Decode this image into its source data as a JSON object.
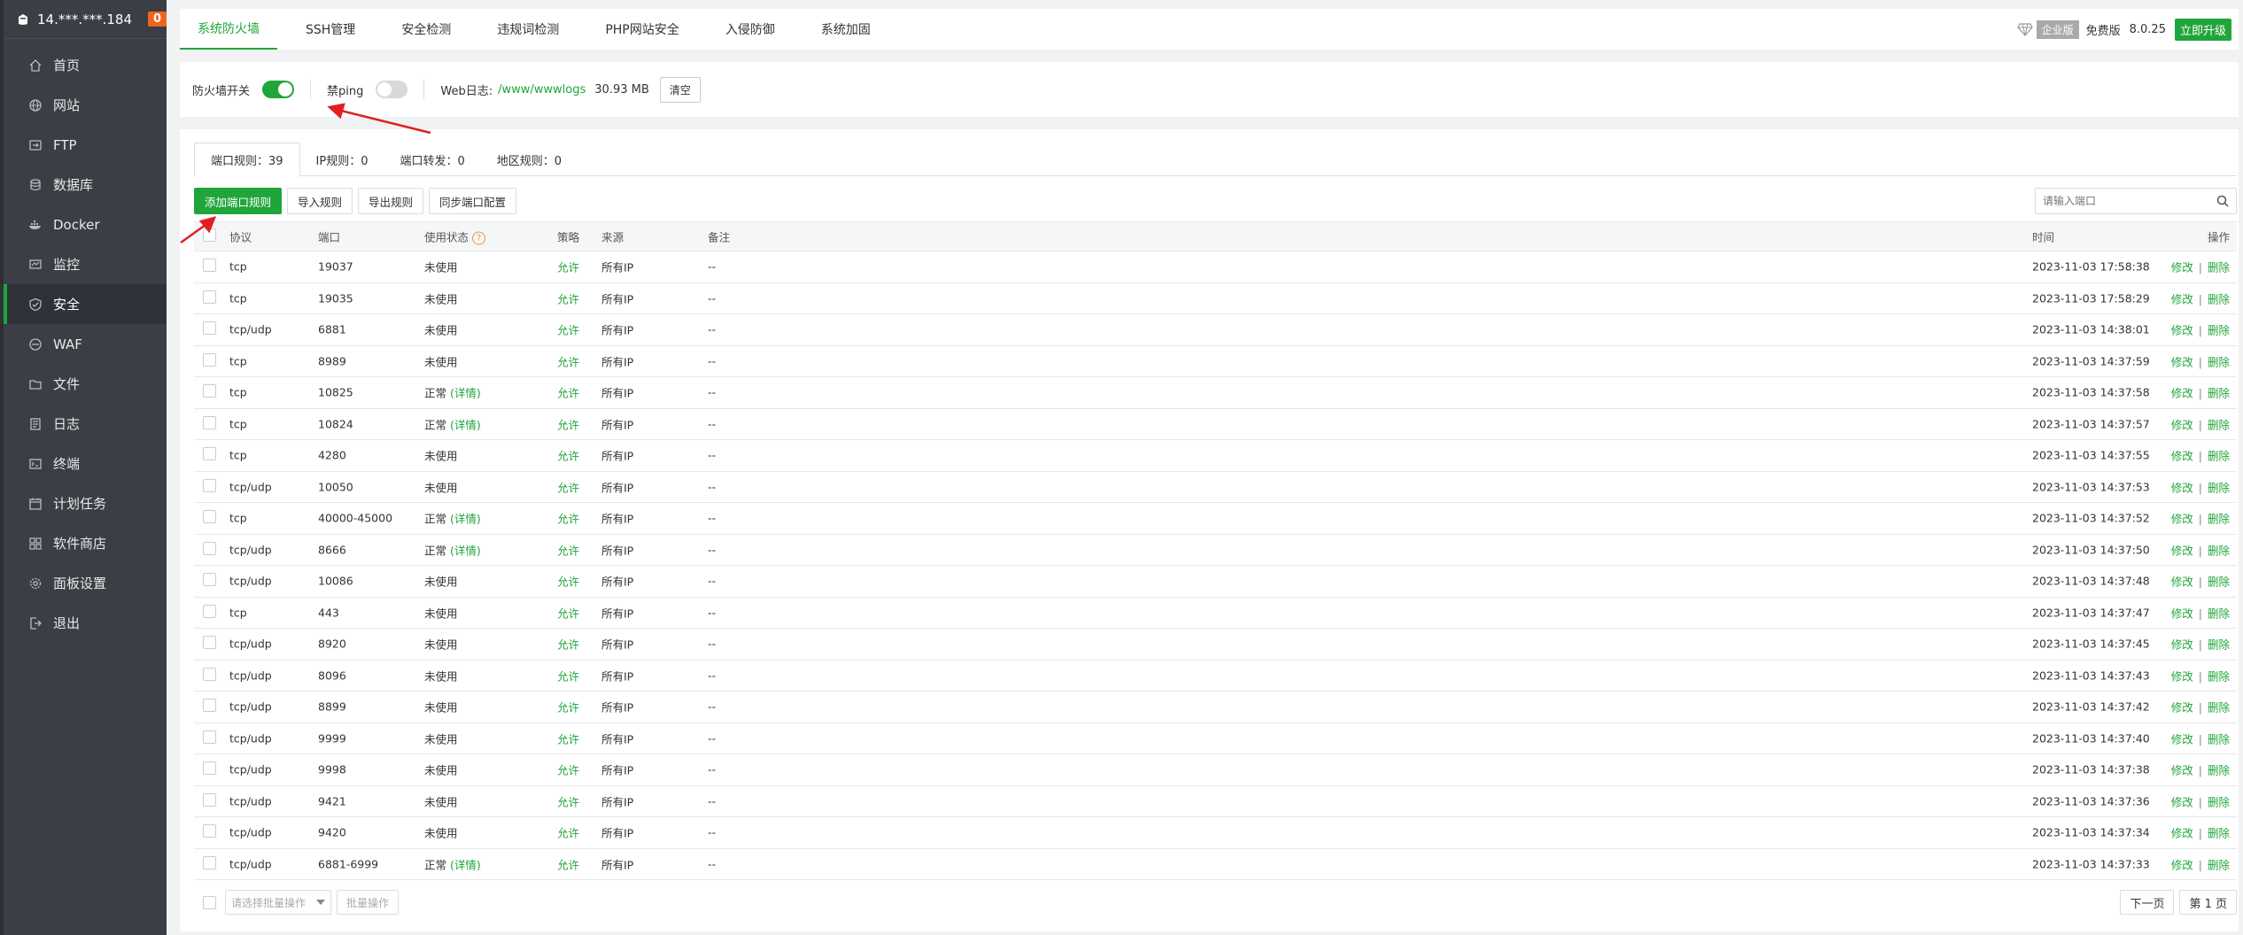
{
  "sidebar": {
    "server_ip": "14.***.***.184",
    "badge": "0",
    "items": [
      {
        "label": "首页",
        "icon": "home-icon"
      },
      {
        "label": "网站",
        "icon": "globe-icon"
      },
      {
        "label": "FTP",
        "icon": "ftp-icon"
      },
      {
        "label": "数据库",
        "icon": "database-icon"
      },
      {
        "label": "Docker",
        "icon": "docker-icon"
      },
      {
        "label": "监控",
        "icon": "monitor-icon"
      },
      {
        "label": "安全",
        "icon": "shield-icon",
        "active": true
      },
      {
        "label": "WAF",
        "icon": "waf-icon"
      },
      {
        "label": "文件",
        "icon": "folder-icon"
      },
      {
        "label": "日志",
        "icon": "log-icon"
      },
      {
        "label": "终端",
        "icon": "terminal-icon"
      },
      {
        "label": "计划任务",
        "icon": "calendar-icon"
      },
      {
        "label": "软件商店",
        "icon": "apps-icon"
      },
      {
        "label": "面板设置",
        "icon": "gear-icon"
      },
      {
        "label": "退出",
        "icon": "logout-icon"
      }
    ]
  },
  "topbar": {
    "tabs": [
      "系统防火墙",
      "SSH管理",
      "安全检测",
      "违规词检测",
      "PHP网站安全",
      "入侵防御",
      "系统加固"
    ],
    "active_tab": 0,
    "enterprise": "企业版",
    "free": "免费版",
    "version": "8.0.25",
    "upgrade": "立即升级"
  },
  "firewall": {
    "switch_label": "防火墙开关",
    "switch_on": true,
    "ping_label": "禁ping",
    "ping_on": false,
    "weblog_label": "Web日志:",
    "weblog_path": "/www/wwwlogs",
    "weblog_size": "30.93 MB",
    "clear_label": "清空"
  },
  "subtabs": [
    "端口规则：39",
    "IP规则：0",
    "端口转发：0",
    "地区规则：0"
  ],
  "toolbar": {
    "add": "添加端口规则",
    "import": "导入规则",
    "export": "导出规则",
    "sync": "同步端口配置",
    "search_placeholder": "请输入端口"
  },
  "table": {
    "headers": {
      "proto": "协议",
      "port": "端口",
      "status": "使用状态",
      "policy": "策略",
      "source": "来源",
      "note": "备注",
      "time": "时间",
      "ops": "操作"
    },
    "detail_label": "(详情)",
    "edit_label": "修改",
    "delete_label": "删除",
    "rows": [
      {
        "proto": "tcp",
        "port": "19037",
        "status": "未使用",
        "detail": false,
        "policy": "允许",
        "source": "所有IP",
        "note": "--",
        "time": "2023-11-03 17:58:38"
      },
      {
        "proto": "tcp",
        "port": "19035",
        "status": "未使用",
        "detail": false,
        "policy": "允许",
        "source": "所有IP",
        "note": "--",
        "time": "2023-11-03 17:58:29"
      },
      {
        "proto": "tcp/udp",
        "port": "6881",
        "status": "未使用",
        "detail": false,
        "policy": "允许",
        "source": "所有IP",
        "note": "--",
        "time": "2023-11-03 14:38:01"
      },
      {
        "proto": "tcp",
        "port": "8989",
        "status": "未使用",
        "detail": false,
        "policy": "允许",
        "source": "所有IP",
        "note": "--",
        "time": "2023-11-03 14:37:59"
      },
      {
        "proto": "tcp",
        "port": "10825",
        "status": "正常",
        "detail": true,
        "policy": "允许",
        "source": "所有IP",
        "note": "--",
        "time": "2023-11-03 14:37:58"
      },
      {
        "proto": "tcp",
        "port": "10824",
        "status": "正常",
        "detail": true,
        "policy": "允许",
        "source": "所有IP",
        "note": "--",
        "time": "2023-11-03 14:37:57"
      },
      {
        "proto": "tcp",
        "port": "4280",
        "status": "未使用",
        "detail": false,
        "policy": "允许",
        "source": "所有IP",
        "note": "--",
        "time": "2023-11-03 14:37:55"
      },
      {
        "proto": "tcp/udp",
        "port": "10050",
        "status": "未使用",
        "detail": false,
        "policy": "允许",
        "source": "所有IP",
        "note": "--",
        "time": "2023-11-03 14:37:53"
      },
      {
        "proto": "tcp",
        "port": "40000-45000",
        "status": "正常",
        "detail": true,
        "policy": "允许",
        "source": "所有IP",
        "note": "--",
        "time": "2023-11-03 14:37:52"
      },
      {
        "proto": "tcp/udp",
        "port": "8666",
        "status": "正常",
        "detail": true,
        "policy": "允许",
        "source": "所有IP",
        "note": "--",
        "time": "2023-11-03 14:37:50"
      },
      {
        "proto": "tcp/udp",
        "port": "10086",
        "status": "未使用",
        "detail": false,
        "policy": "允许",
        "source": "所有IP",
        "note": "--",
        "time": "2023-11-03 14:37:48"
      },
      {
        "proto": "tcp",
        "port": "443",
        "status": "未使用",
        "detail": false,
        "policy": "允许",
        "source": "所有IP",
        "note": "--",
        "time": "2023-11-03 14:37:47"
      },
      {
        "proto": "tcp/udp",
        "port": "8920",
        "status": "未使用",
        "detail": false,
        "policy": "允许",
        "source": "所有IP",
        "note": "--",
        "time": "2023-11-03 14:37:45"
      },
      {
        "proto": "tcp/udp",
        "port": "8096",
        "status": "未使用",
        "detail": false,
        "policy": "允许",
        "source": "所有IP",
        "note": "--",
        "time": "2023-11-03 14:37:43"
      },
      {
        "proto": "tcp/udp",
        "port": "8899",
        "status": "未使用",
        "detail": false,
        "policy": "允许",
        "source": "所有IP",
        "note": "--",
        "time": "2023-11-03 14:37:42"
      },
      {
        "proto": "tcp/udp",
        "port": "9999",
        "status": "未使用",
        "detail": false,
        "policy": "允许",
        "source": "所有IP",
        "note": "--",
        "time": "2023-11-03 14:37:40"
      },
      {
        "proto": "tcp/udp",
        "port": "9998",
        "status": "未使用",
        "detail": false,
        "policy": "允许",
        "source": "所有IP",
        "note": "--",
        "time": "2023-11-03 14:37:38"
      },
      {
        "proto": "tcp/udp",
        "port": "9421",
        "status": "未使用",
        "detail": false,
        "policy": "允许",
        "source": "所有IP",
        "note": "--",
        "time": "2023-11-03 14:37:36"
      },
      {
        "proto": "tcp/udp",
        "port": "9420",
        "status": "未使用",
        "detail": false,
        "policy": "允许",
        "source": "所有IP",
        "note": "--",
        "time": "2023-11-03 14:37:34"
      },
      {
        "proto": "tcp/udp",
        "port": "6881-6999",
        "status": "正常",
        "detail": true,
        "policy": "允许",
        "source": "所有IP",
        "note": "--",
        "time": "2023-11-03 14:37:33"
      }
    ]
  },
  "footer": {
    "batch_placeholder": "请选择批量操作",
    "batch_button": "批量操作",
    "next_page": "下一页",
    "page": "第 1 页"
  },
  "colors": {
    "accent": "#20a53a",
    "sidebar": "#3b3e45",
    "badge": "#f0641e",
    "annotation": "#e02020"
  }
}
